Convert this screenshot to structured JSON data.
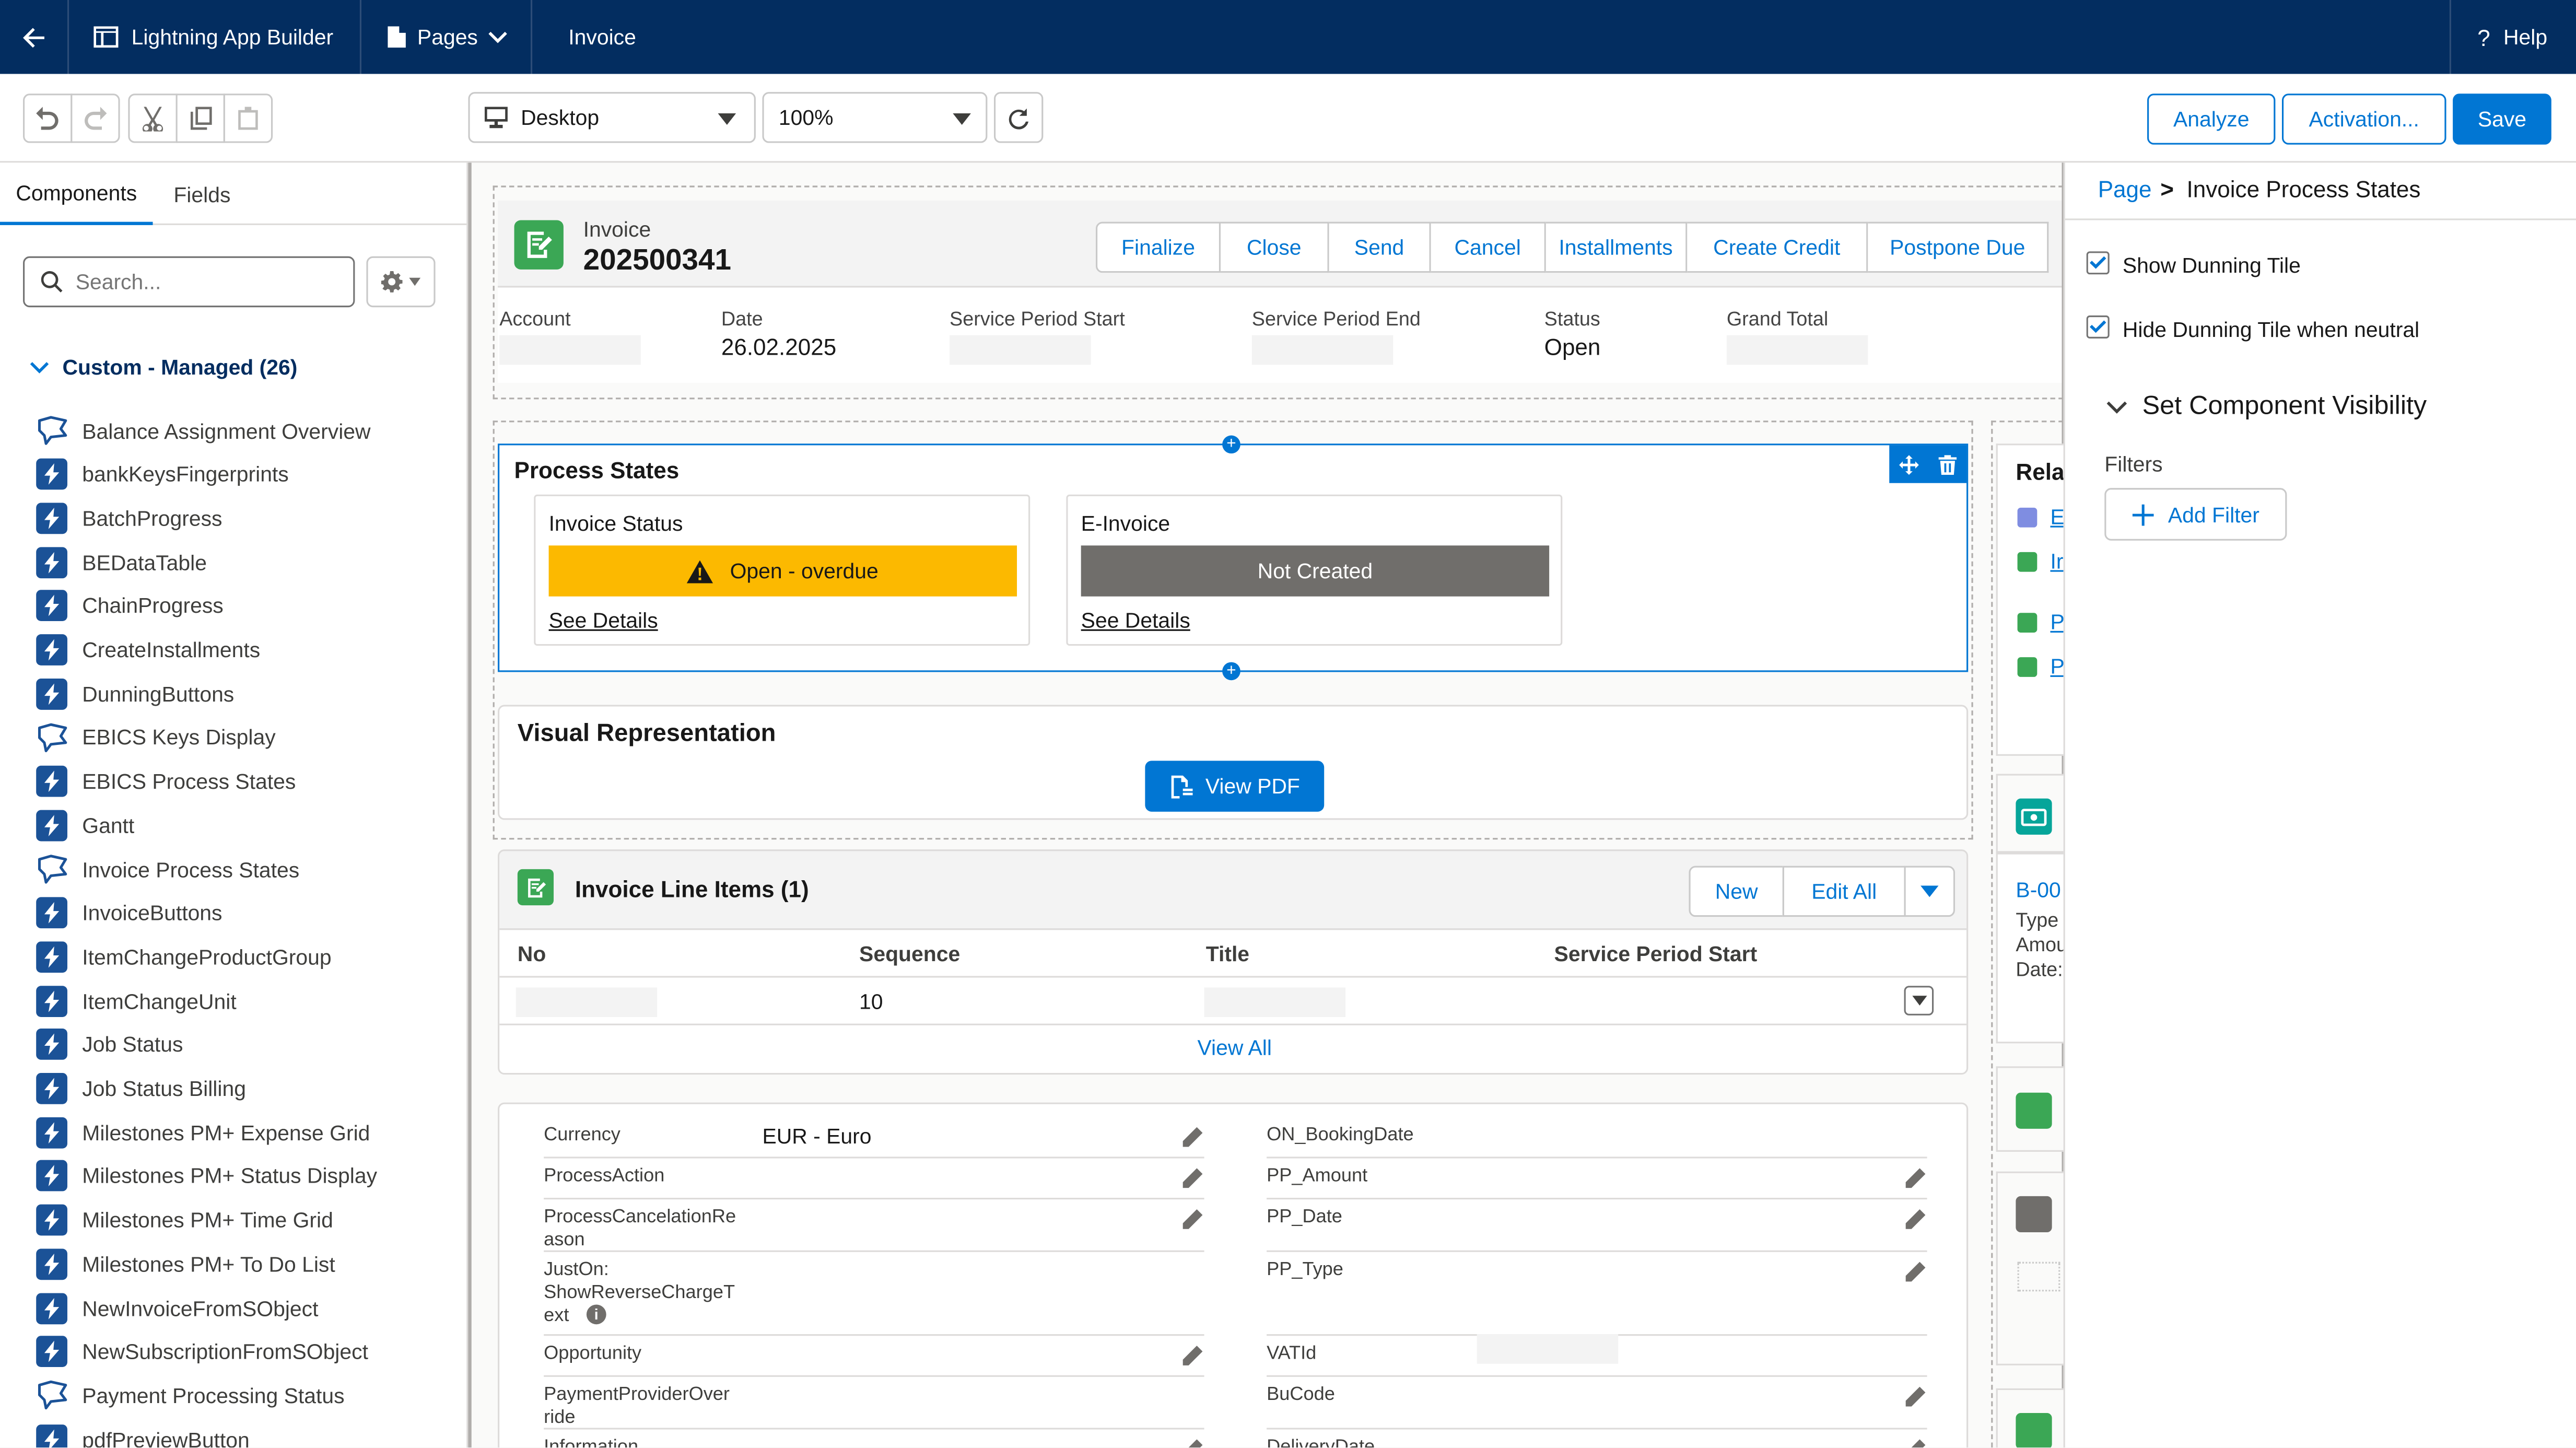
{
  "header": {
    "back_icon": "arrow-left-icon",
    "app_name": "Lightning App Builder",
    "pages_label": "Pages",
    "page_name": "Invoice",
    "help_label": "Help"
  },
  "toolbar": {
    "device": "Desktop",
    "zoom": "100%",
    "analyze": "Analyze",
    "activation": "Activation...",
    "save": "Save"
  },
  "left": {
    "tabs": [
      "Components",
      "Fields"
    ],
    "search_placeholder": "Search...",
    "section_title": "Custom - Managed (26)",
    "components": [
      {
        "label": "Balance Assignment Overview",
        "icon": "flag"
      },
      {
        "label": "bankKeysFingerprints",
        "icon": "bolt"
      },
      {
        "label": "BatchProgress",
        "icon": "bolt"
      },
      {
        "label": "BEDataTable",
        "icon": "bolt"
      },
      {
        "label": "ChainProgress",
        "icon": "bolt"
      },
      {
        "label": "CreateInstallments",
        "icon": "bolt"
      },
      {
        "label": "DunningButtons",
        "icon": "bolt"
      },
      {
        "label": "EBICS Keys Display",
        "icon": "flag"
      },
      {
        "label": "EBICS Process States",
        "icon": "bolt"
      },
      {
        "label": "Gantt",
        "icon": "bolt"
      },
      {
        "label": "Invoice Process States",
        "icon": "flag"
      },
      {
        "label": "InvoiceButtons",
        "icon": "bolt"
      },
      {
        "label": "ItemChangeProductGroup",
        "icon": "bolt"
      },
      {
        "label": "ItemChangeUnit",
        "icon": "bolt"
      },
      {
        "label": "Job Status",
        "icon": "bolt"
      },
      {
        "label": "Job Status Billing",
        "icon": "bolt"
      },
      {
        "label": "Milestones PM+ Expense Grid",
        "icon": "bolt"
      },
      {
        "label": "Milestones PM+ Status Display",
        "icon": "bolt"
      },
      {
        "label": "Milestones PM+ Time Grid",
        "icon": "bolt"
      },
      {
        "label": "Milestones PM+ To Do List",
        "icon": "bolt"
      },
      {
        "label": "NewInvoiceFromSObject",
        "icon": "bolt"
      },
      {
        "label": "NewSubscriptionFromSObject",
        "icon": "bolt"
      },
      {
        "label": "Payment Processing Status",
        "icon": "flag"
      },
      {
        "label": "pdfPreviewButton",
        "icon": "bolt"
      }
    ]
  },
  "record": {
    "object": "Invoice",
    "number": "202500341",
    "actions": [
      "Finalize",
      "Close",
      "Send",
      "Cancel",
      "Installments",
      "Create Credit",
      "Postpone Due"
    ],
    "fields": [
      {
        "label": "Account",
        "value": ""
      },
      {
        "label": "Date",
        "value": "26.02.2025"
      },
      {
        "label": "Service Period Start",
        "value": ""
      },
      {
        "label": "Service Period End",
        "value": ""
      },
      {
        "label": "Status",
        "value": "Open"
      },
      {
        "label": "Grand Total",
        "value": ""
      }
    ]
  },
  "process": {
    "title": "Process States",
    "tiles": [
      {
        "title": "Invoice Status",
        "status": "Open - overdue",
        "link": "See Details"
      },
      {
        "title": "E-Invoice",
        "status": "Not Created",
        "link": "See Details"
      }
    ]
  },
  "visual": {
    "title": "Visual Representation",
    "button": "View PDF"
  },
  "line_items": {
    "title": "Invoice Line Items (1)",
    "new": "New",
    "edit_all": "Edit All",
    "columns": [
      "No",
      "Sequence",
      "Title",
      "Service Period Start"
    ],
    "rows": [
      {
        "no": "",
        "sequence": "10",
        "title": "",
        "start": ""
      }
    ],
    "view_all": "View All"
  },
  "detail": {
    "left": [
      {
        "label": "Currency",
        "value": "EUR - Euro"
      },
      {
        "label": "ProcessAction",
        "value": ""
      },
      {
        "label": "ProcessCancelationReason",
        "value": ""
      },
      {
        "label": "JustOn: ShowReverseChargeText",
        "value": ""
      },
      {
        "label": "Opportunity",
        "value": ""
      },
      {
        "label": "PaymentProviderOverride",
        "value": ""
      },
      {
        "label": "Information",
        "value": ""
      }
    ],
    "right": [
      {
        "label": "ON_BookingDate",
        "value": ""
      },
      {
        "label": "PP_Amount",
        "value": ""
      },
      {
        "label": "PP_Date",
        "value": ""
      },
      {
        "label": "PP_Type",
        "value": ""
      },
      {
        "label": "VATId",
        "value": ""
      },
      {
        "label": "BuCode",
        "value": ""
      },
      {
        "label": "DeliveryDate",
        "value": ""
      }
    ]
  },
  "related": {
    "title": "Rela",
    "links": [
      "E",
      "Ir",
      "P",
      "P"
    ],
    "card_title": "B-00",
    "card_lines": [
      "Type",
      "Amou",
      "Date:"
    ]
  },
  "props": {
    "breadcrumb_root": "Page",
    "breadcrumb_sep": ">",
    "breadcrumb_current": "Invoice Process States",
    "show_dunning": "Show Dunning Tile",
    "hide_dunning": "Hide Dunning Tile when neutral",
    "visibility_title": "Set Component Visibility",
    "filters_label": "Filters",
    "add_filter": "Add Filter"
  },
  "colors": {
    "header": "#032d60",
    "brand": "#0176d3",
    "warning": "#fcb900",
    "neutral": "#706e6b"
  }
}
